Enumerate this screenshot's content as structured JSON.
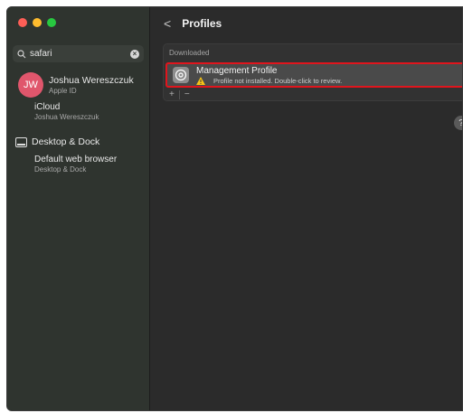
{
  "window": {
    "controls": [
      "close",
      "minimize",
      "zoom"
    ]
  },
  "sidebar": {
    "search": {
      "value": "safari",
      "icon": "search-icon"
    },
    "account": {
      "initials": "JW",
      "name": "Joshua Wereszczuk",
      "subtitle": "Apple ID",
      "avatar_color": "#e0566c"
    },
    "icloud": {
      "name": "iCloud",
      "subtitle": "Joshua Wereszczuk"
    },
    "desktop_dock": {
      "label": "Desktop & Dock",
      "icon": "dock-icon"
    },
    "default_browser": {
      "name": "Default web browser",
      "subtitle": "Desktop & Dock"
    }
  },
  "main": {
    "back_label": "<",
    "title": "Profiles",
    "section_label": "Downloaded",
    "profile": {
      "name": "Management Profile",
      "status": "Profile not installed. Double-click to review.",
      "highlight_color": "#e0151d"
    },
    "add_label": "+",
    "remove_label": "−",
    "help_label": "?"
  }
}
